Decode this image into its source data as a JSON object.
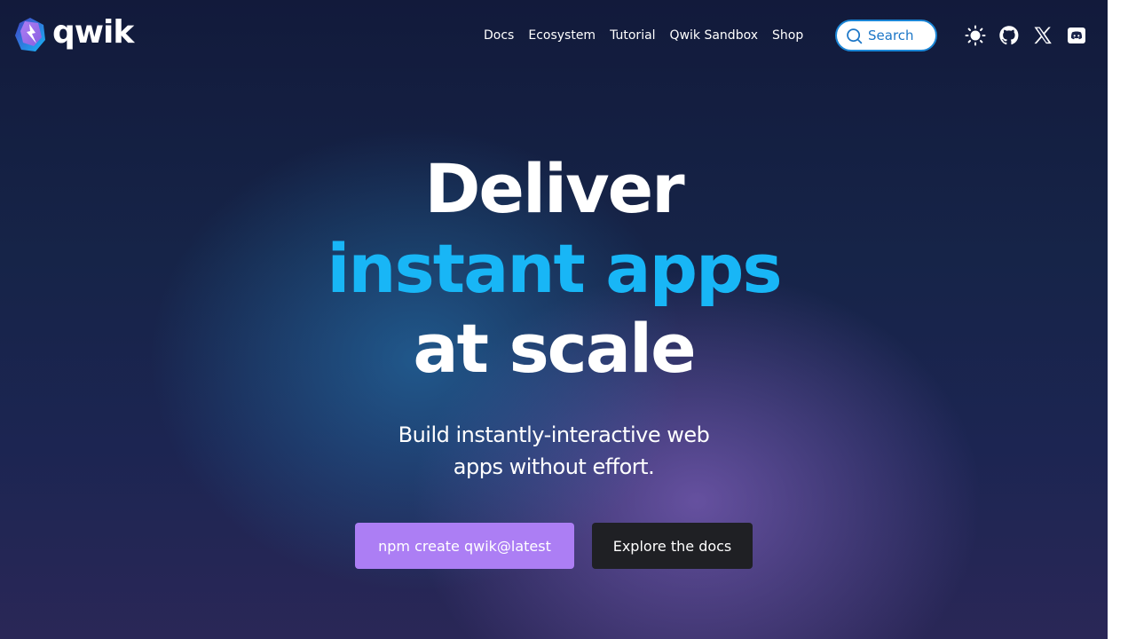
{
  "brand": {
    "name": "qwik",
    "colors": {
      "accent_blue": "#18b6f6",
      "accent_purple": "#ac7ef4",
      "dark_button": "#1f2024",
      "search_border": "#1b86d6"
    }
  },
  "nav": {
    "links": [
      "Docs",
      "Ecosystem",
      "Tutorial",
      "Qwik Sandbox",
      "Shop"
    ]
  },
  "search": {
    "label": "Search",
    "icon": "search-icon"
  },
  "toolbar_icons": [
    "sun-icon",
    "github-icon",
    "x-icon",
    "discord-icon"
  ],
  "hero": {
    "line1": "Deliver",
    "line2": "instant apps",
    "line3": "at scale"
  },
  "subtitle": {
    "line1": "Build instantly-interactive web",
    "line2": "apps without effort."
  },
  "cta": {
    "primary_label": "npm create qwik@latest",
    "secondary_label": "Explore the docs"
  }
}
